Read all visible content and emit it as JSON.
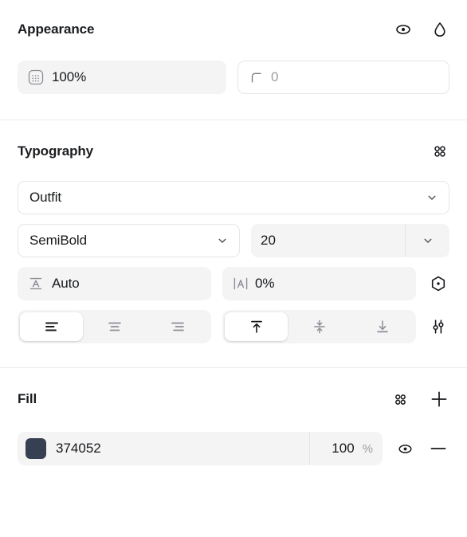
{
  "panel": {
    "sections": [
      {
        "id": "appearance",
        "title": "Appearance",
        "actions": [
          "eye-icon",
          "blend-mode-icon"
        ],
        "opacity": {
          "icon": "opacity-grid-icon",
          "value": "100%"
        },
        "corner_radius": {
          "icon": "corner-radius-icon",
          "value": "0",
          "placeholder": "0"
        }
      },
      {
        "id": "typography",
        "title": "Typography",
        "actions": [
          "style-library-icon"
        ],
        "font_family": {
          "value": "Outfit",
          "chevron": "chevron-down-icon"
        },
        "font_weight": {
          "value": "SemiBold",
          "chevron": "chevron-down-icon"
        },
        "font_size": {
          "value": "20",
          "chevron": "chevron-down-icon"
        },
        "line_height": {
          "icon": "line-height-icon",
          "value": "Auto"
        },
        "letter_spacing": {
          "icon": "letter-spacing-icon",
          "value": "0%"
        },
        "text_settings_icon": "hexagon-dot-icon",
        "align_settings_icon": "sliders-icon",
        "horizontal_align": {
          "options": [
            "align-left",
            "align-center",
            "align-right"
          ],
          "selected": "align-left"
        },
        "vertical_align": {
          "options": [
            "align-top",
            "align-middle",
            "align-bottom"
          ],
          "selected": "align-top"
        }
      },
      {
        "id": "fill",
        "title": "Fill",
        "actions": [
          "style-library-icon",
          "add-icon"
        ],
        "item": {
          "color_hex": "374052",
          "swatch_color": "#374052",
          "opacity": "100",
          "opacity_unit": "%",
          "visibility_icon": "eye-icon",
          "remove_icon": "minus-icon"
        }
      }
    ]
  },
  "colors": {
    "field_bg": "#f4f4f5",
    "text": "#17191c",
    "muted": "#9a9da3",
    "divider": "#ececee",
    "icon": "#16181c"
  }
}
